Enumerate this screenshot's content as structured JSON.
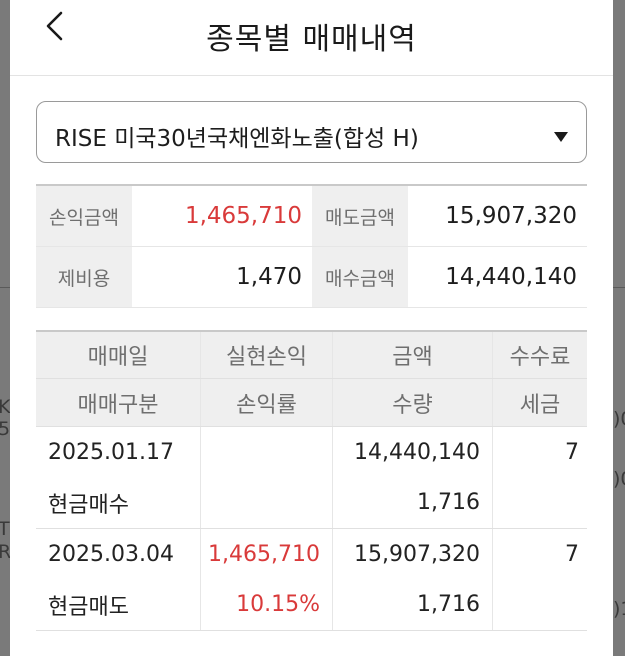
{
  "background": {
    "fragments": [
      "K(",
      "5(",
      "T",
      "R(",
      ")0",
      ")0",
      ")1"
    ]
  },
  "header": {
    "back_icon": "chevron-left-icon",
    "title": "종목별 매매내역"
  },
  "selector": {
    "selected": "RISE 미국30년국채엔화노출(합성 H)",
    "arrow_icon": "triangle-down-icon"
  },
  "summary": {
    "profit_label": "손익금액",
    "profit_value": "1,465,710",
    "sell_label": "매도금액",
    "sell_value": "15,907,320",
    "cost_label": "제비용",
    "cost_value": "1,470",
    "buy_label": "매수금액",
    "buy_value": "14,440,140"
  },
  "trades": {
    "headers_row1": [
      "매매일",
      "실현손익",
      "금액",
      "수수료"
    ],
    "headers_row2": [
      "매매구분",
      "손익률",
      "수량",
      "세금"
    ],
    "rows": [
      {
        "date": "2025.01.17",
        "realized": "",
        "amount": "14,440,140",
        "fee": "7",
        "type": "현금매수",
        "rate": "",
        "qty": "1,716",
        "tax": ""
      },
      {
        "date": "2025.03.04",
        "realized": "1,465,710",
        "amount": "15,907,320",
        "fee": "7",
        "type": "현금매도",
        "rate": "10.15%",
        "qty": "1,716",
        "tax": ""
      }
    ]
  },
  "colors": {
    "profit_red": "#d93a3a",
    "label_bg": "#efefef"
  }
}
